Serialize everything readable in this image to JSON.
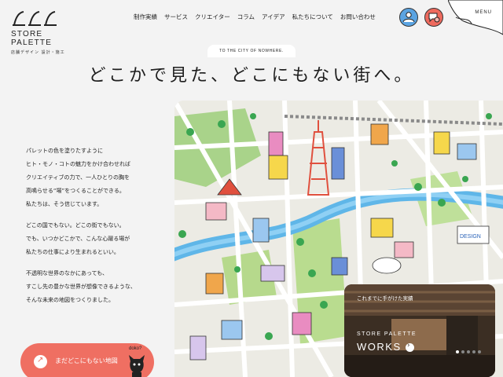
{
  "brand": {
    "name": "STORE PALETTE",
    "subtitle": "店舗デザイン 設計・施工"
  },
  "nav": {
    "items": [
      "制作実績",
      "サービス",
      "クリエイター",
      "コラム",
      "アイデア",
      "私たちについて",
      "お問い合わせ"
    ]
  },
  "header": {
    "menu_label": "MENU",
    "icons": [
      "person-icon",
      "chat-icon"
    ],
    "colors": {
      "person": "#5ba4e2",
      "chat": "#ee6a5e"
    }
  },
  "hero": {
    "tagline": "TO THE CITY OF NOWHERE.",
    "headline": "どこかで見た、どこにもない街へ。",
    "paragraphs": [
      [
        "パレットの色を塗りたすように",
        "ヒト・モノ・コトの魅力をかけ合わせれば",
        "クリエイティブの力で、一人ひとりの胸を",
        "高鳴らせる“場”をつくることができる。",
        "私たちは、そう信じています。"
      ],
      [
        "どこの国でもない。どこの街でもない。",
        "でも、いつかどこかで、こんな心躍る場が",
        "私たちの仕事により生まれるといい。"
      ],
      [
        "不透明な世界のなかにあっても、",
        "すこし先の豊かな世界が想像できるような、",
        "そんな未来の地図をつくりました。"
      ]
    ]
  },
  "cta": {
    "label": "まだどこにもない地図",
    "note": "doko?",
    "color": "#ef6f62"
  },
  "map": {
    "labels": [
      "DESIGN"
    ]
  },
  "works": {
    "caption": "これまでに手がけた実績",
    "brand": "STORE PALETTE",
    "title": "WORKS",
    "slides": 5,
    "active": 0
  }
}
